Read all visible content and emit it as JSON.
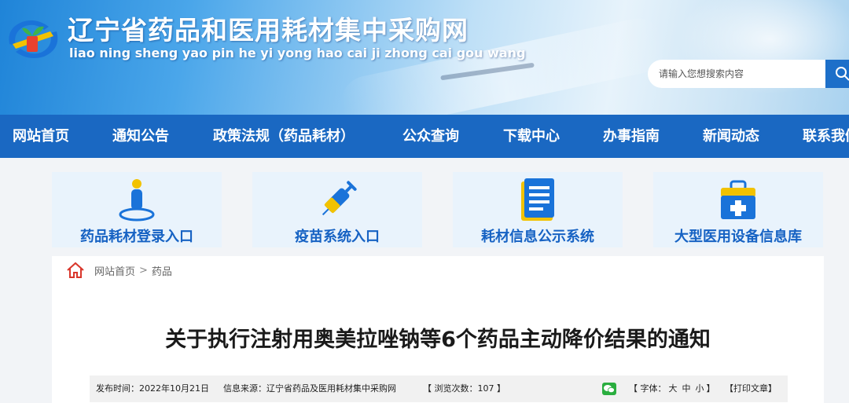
{
  "header": {
    "title": "辽宁省药品和医用耗材集中采购网",
    "subtitle": "liao ning sheng yao pin he yi yong hao cai ji zhong cai gou wang",
    "search": {
      "placeholder": "请输入您想搜索内容"
    }
  },
  "nav": {
    "items": [
      {
        "label": "网站首页"
      },
      {
        "label": "通知公告"
      },
      {
        "label": "政策法规（药品耗材）"
      },
      {
        "label": "公众查询"
      },
      {
        "label": "下载中心"
      },
      {
        "label": "办事指南"
      },
      {
        "label": "新闻动态"
      },
      {
        "label": "联系我们"
      }
    ]
  },
  "cards": [
    {
      "label": "药品耗材登录入口",
      "icon": "person-icon"
    },
    {
      "label": "疫苗系统入口",
      "icon": "syringe-icon"
    },
    {
      "label": "耗材信息公示系统",
      "icon": "document-icon"
    },
    {
      "label": "大型医用设备信息库",
      "icon": "medical-kit-icon"
    }
  ],
  "breadcrumb": {
    "home": "网站首页",
    "separator": ">",
    "current": "药品"
  },
  "article": {
    "title": "关于执行注射用奥美拉唑钠等6个药品主动降价结果的通知",
    "meta": {
      "publish_time": "发布时间：2022年10月21日",
      "source": "信息来源：辽宁省药品及医用耗材集中采购网",
      "views_open": "【",
      "views": "浏览次数：107",
      "views_close": "】",
      "font_open": "【 字体：",
      "font_large": "大",
      "font_medium": "中",
      "font_small": "小",
      "font_close": "】",
      "print": "【打印文章】"
    }
  },
  "colors": {
    "nav_bg": "#1a68c2",
    "card_bg": "#e9f3fc",
    "card_text": "#1662c3",
    "icon_blue": "#1a73d9",
    "icon_yellow": "#f2c200"
  }
}
